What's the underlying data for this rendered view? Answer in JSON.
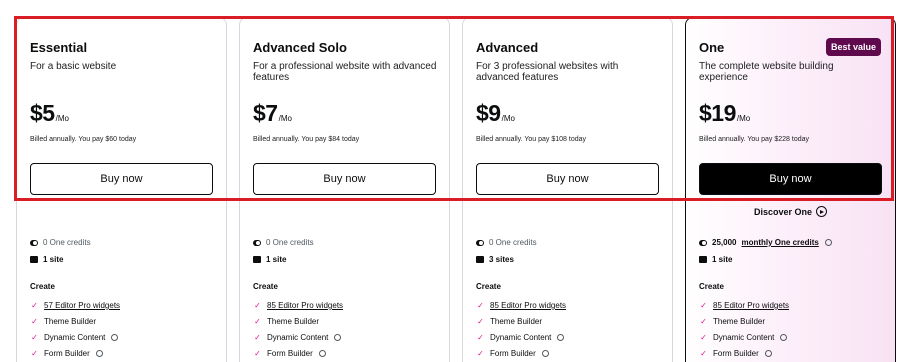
{
  "plans": [
    {
      "name": "Essential",
      "desc": "For a basic website",
      "price": "$5",
      "unit": "/Mo",
      "billed": "Billed annually. You pay $60 today",
      "button": "Buy now",
      "credits": "0 One credits",
      "sites": "1 site",
      "create": "Create",
      "features": [
        "57 Editor Pro widgets",
        "Theme Builder",
        "Dynamic Content",
        "Form Builder"
      ]
    },
    {
      "name": "Advanced Solo",
      "desc": "For a professional website with advanced features",
      "price": "$7",
      "unit": "/Mo",
      "billed": "Billed annually. You pay $84 today",
      "button": "Buy now",
      "credits": "0 One credits",
      "sites": "1 site",
      "create": "Create",
      "features": [
        "85 Editor Pro widgets",
        "Theme Builder",
        "Dynamic Content",
        "Form Builder"
      ]
    },
    {
      "name": "Advanced",
      "desc": "For 3 professional websites with advanced features",
      "price": "$9",
      "unit": "/Mo",
      "billed": "Billed annually. You pay $108 today",
      "button": "Buy now",
      "credits": "0 One credits",
      "sites": "3 sites",
      "create": "Create",
      "features": [
        "85 Editor Pro widgets",
        "Theme Builder",
        "Dynamic Content",
        "Form Builder"
      ]
    },
    {
      "name": "One",
      "badge": "Best value",
      "desc": "The complete website building experience",
      "price": "$19",
      "unit": "/Mo",
      "billed": "Billed annually. You pay $228 today",
      "button": "Buy now",
      "discover": "Discover One",
      "credits_amount": "25,000",
      "credits_label": "monthly One credits",
      "sites": "1 site",
      "create": "Create",
      "features": [
        "85 Editor Pro widgets",
        "Theme Builder",
        "Dynamic Content",
        "Form Builder"
      ]
    }
  ],
  "colors": {
    "accent_check": "#d5158a",
    "badge_bg": "#5e0a4d",
    "highlight_border": "#d91c26"
  }
}
